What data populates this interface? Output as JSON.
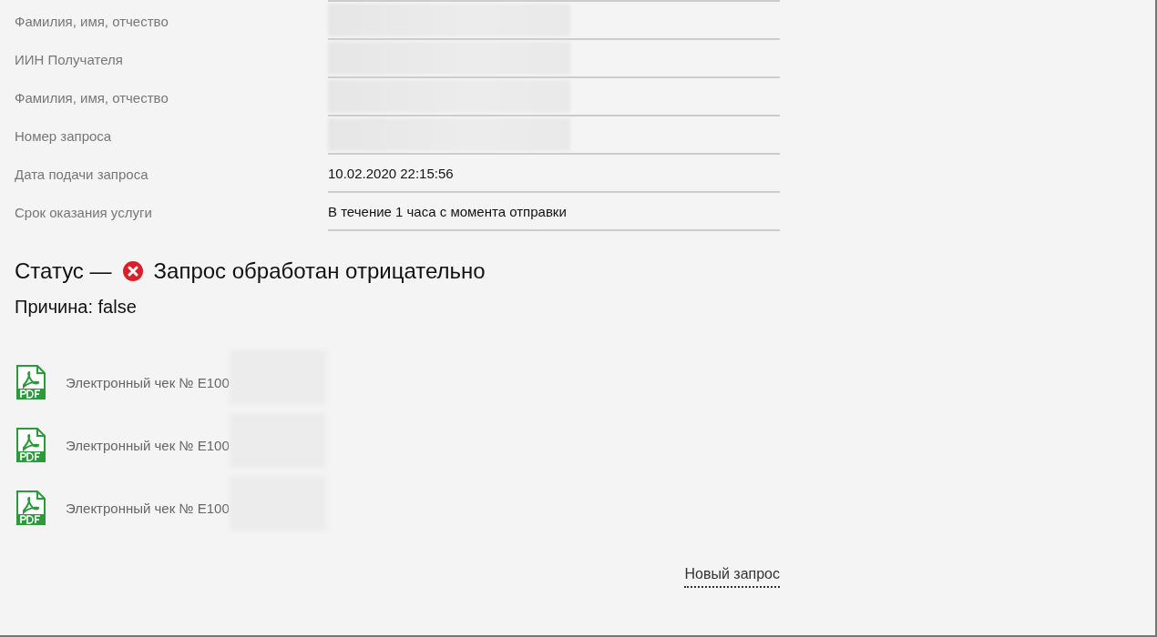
{
  "details": [
    {
      "label": "Фамилия, имя, отчество",
      "redacted": true
    },
    {
      "label": "ИИН Получателя",
      "redacted": true
    },
    {
      "label": "Фамилия, имя, отчество",
      "redacted": true
    },
    {
      "label": "Номер запроса",
      "redacted": true
    },
    {
      "label": "Дата подачи запроса",
      "value": "10.02.2020 22:15:56"
    },
    {
      "label": "Срок оказания услуги",
      "value": "В течение 1 часа с момента отправки"
    }
  ],
  "status": {
    "prefix": "Статус —",
    "kind": "error",
    "text": "Запрос обработан отрицательно"
  },
  "reason": "Причина: false",
  "receipts": [
    {
      "label": "Электронный чек № E100",
      "redacted": true
    },
    {
      "label": "Электронный чек № E100",
      "redacted": true
    },
    {
      "label": "Электронный чек № E100",
      "redacted": true
    }
  ],
  "new_request_link": "Новый запрос"
}
